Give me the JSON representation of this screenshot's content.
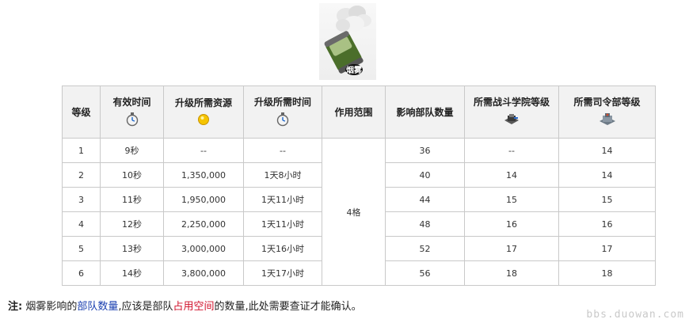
{
  "header": {
    "spell_badge": "烟雾",
    "columns": [
      "等级",
      "有效时间",
      "升级所需资源",
      "升级所需时间",
      "作用范围",
      "影响部队数量",
      "所需战斗学院等级",
      "所需司令部等级"
    ],
    "icons": [
      "",
      "stopwatch-icon",
      "gold-coin-icon",
      "stopwatch-icon",
      "",
      "",
      "armory-building-icon",
      "headquarters-building-icon"
    ]
  },
  "table": {
    "range": "4格",
    "rows": [
      {
        "level": "1",
        "duration": "9秒",
        "cost": "--",
        "time": "--",
        "troops": "36",
        "armory": "--",
        "hq": "14"
      },
      {
        "level": "2",
        "duration": "10秒",
        "cost": "1,350,000",
        "time": "1天8小时",
        "troops": "40",
        "armory": "14",
        "hq": "14"
      },
      {
        "level": "3",
        "duration": "11秒",
        "cost": "1,950,000",
        "time": "1天11小时",
        "troops": "44",
        "armory": "15",
        "hq": "15"
      },
      {
        "level": "4",
        "duration": "12秒",
        "cost": "2,250,000",
        "time": "1天11小时",
        "troops": "48",
        "armory": "16",
        "hq": "16"
      },
      {
        "level": "5",
        "duration": "13秒",
        "cost": "3,000,000",
        "time": "1天16小时",
        "troops": "52",
        "armory": "17",
        "hq": "17"
      },
      {
        "level": "6",
        "duration": "14秒",
        "cost": "3,800,000",
        "time": "1天17小时",
        "troops": "56",
        "armory": "18",
        "hq": "18"
      }
    ]
  },
  "note": {
    "label": "注:",
    "p1": "烟雾影响的",
    "link": "部队数量",
    "p2": ",应该是部队",
    "red": "占用空间",
    "p3": "的数量,此处需要查证才能确认。"
  },
  "watermark": "bbs.duowan.com",
  "colors": {
    "link": "#1a3fb0",
    "highlight": "#d0102a",
    "time_text": "#0b2a8c",
    "header_bg": "#f2f2f2",
    "border": "#c9c9c9"
  }
}
